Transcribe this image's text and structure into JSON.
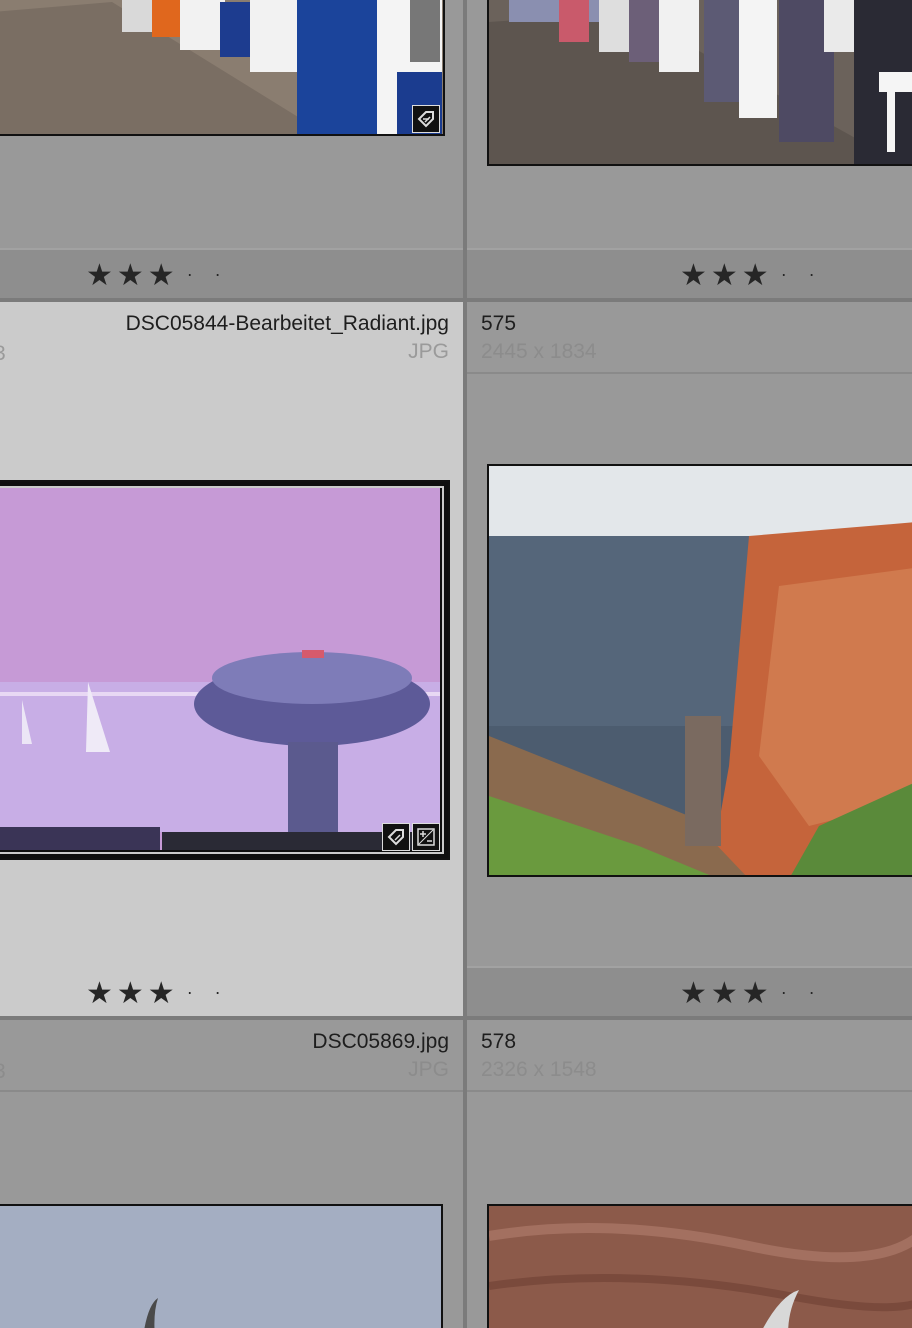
{
  "cells": {
    "c1": {
      "rating_stars": "★★★",
      "rating_dots": "··"
    },
    "c2": {
      "rating_stars": "★★★",
      "rating_dots": "··"
    },
    "c3": {
      "filename": "DSC05844-Bearbeitet_Radiant.jpg",
      "format": "JPG",
      "rating_stars": "★★★",
      "rating_dots": "··"
    },
    "c4": {
      "number": "575",
      "dimensions": "2445 x 1834",
      "rating_stars": "★★★",
      "rating_dots": "··"
    },
    "c5": {
      "filename": "DSC05869.jpg",
      "format": "JPG"
    },
    "c6": {
      "number": "578",
      "dimensions": "2326 x 1548"
    }
  },
  "icons": {
    "metadata_badge": "tag-icon",
    "develop_badge": "plus-minus-icon"
  },
  "colors": {
    "grid_bg": "#999999",
    "selected_bg": "#cbcbcb",
    "divider": "#7b7b7b"
  }
}
